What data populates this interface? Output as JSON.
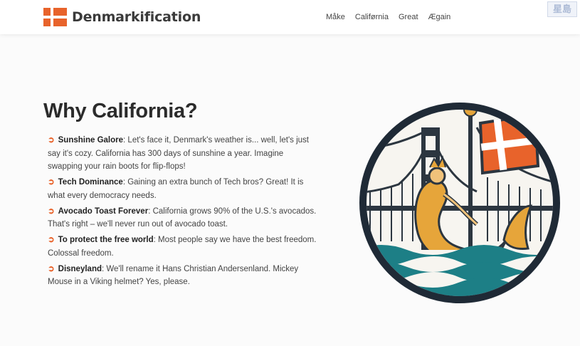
{
  "brand": {
    "name": "Denmarkification",
    "flag_color": "#e8632b",
    "flag_icon": "danish-flag-icon"
  },
  "nav": {
    "links": [
      "Måke",
      "Califørnia",
      "Great",
      "Ægain"
    ]
  },
  "watermark": {
    "text": "星島"
  },
  "main": {
    "title": "Why California?",
    "bullet_icon": "orange-arrow-bullet-icon",
    "reasons": [
      {
        "title": "Sunshine Galore",
        "text": ": Let's face it, Denmark's weather is... well, let's just say it's cozy. California has 300 days of sunshine a year. Imagine swapping your rain boots for flip-flops!"
      },
      {
        "title": "Tech Dominance",
        "text": ": Gaining an extra bunch of Tech bros? Great! It is what every democracy needs."
      },
      {
        "title": "Avocado Toast Forever",
        "text": ": California grows 90% of the U.S.'s avocados. That's right – we'll never run out of avocado toast."
      },
      {
        "title": "To protect the free world",
        "text": ": Most people say we have the best freedom. Colossal freedom."
      },
      {
        "title": "Disneyland",
        "text": ": We'll rename it Hans Christian Andersenland. Mickey Mouse in a Viking helmet? Yes, please."
      }
    ]
  },
  "illustration": {
    "description_icon": "mermaid-golden-gate-bridge-emblem",
    "colors": {
      "ring": "#1f2a36",
      "flag": "#e8632b",
      "water": "#1d7f86",
      "mermaid": "#e6a53a"
    }
  }
}
